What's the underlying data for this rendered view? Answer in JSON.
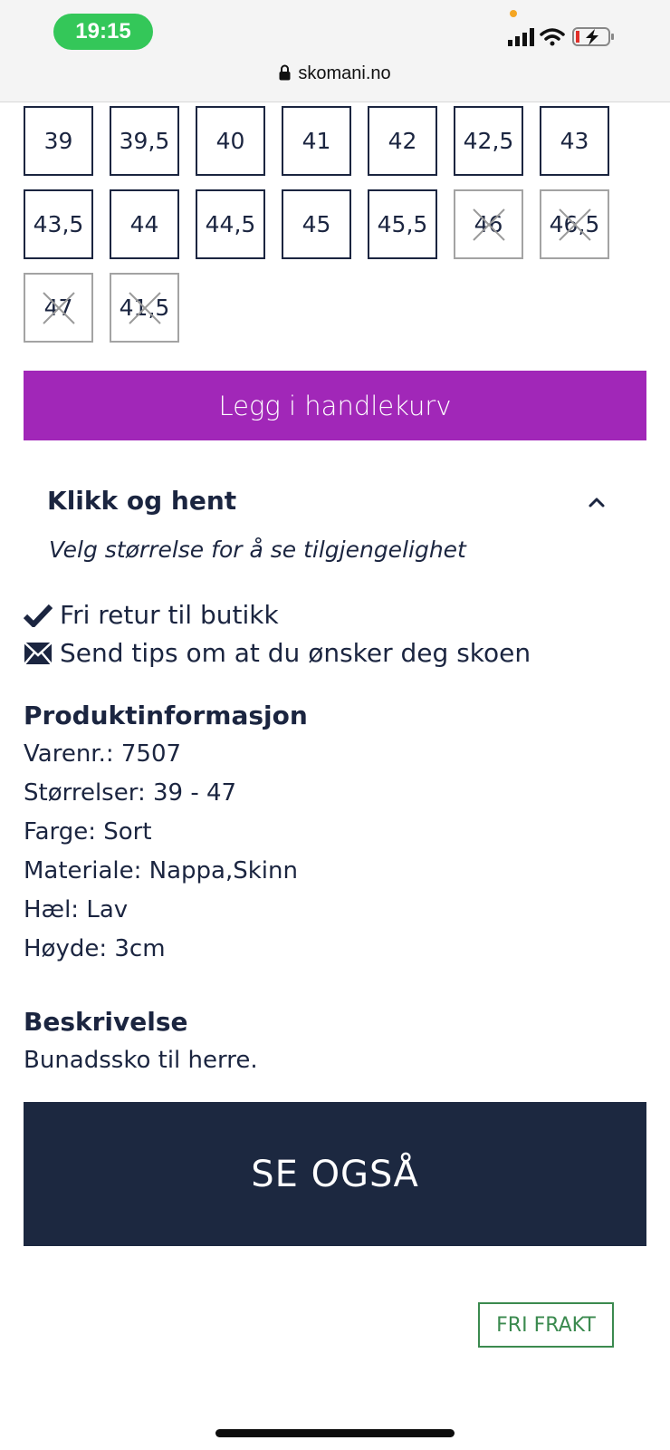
{
  "status_bar": {
    "time": "19:15"
  },
  "browser": {
    "url": "skomani.no"
  },
  "sizes": [
    {
      "label": "39",
      "available": true
    },
    {
      "label": "39,5",
      "available": true
    },
    {
      "label": "40",
      "available": true
    },
    {
      "label": "41",
      "available": true
    },
    {
      "label": "42",
      "available": true
    },
    {
      "label": "42,5",
      "available": true
    },
    {
      "label": "43",
      "available": true
    },
    {
      "label": "43,5",
      "available": true
    },
    {
      "label": "44",
      "available": true
    },
    {
      "label": "44,5",
      "available": true
    },
    {
      "label": "45",
      "available": true
    },
    {
      "label": "45,5",
      "available": true
    },
    {
      "label": "46",
      "available": false
    },
    {
      "label": "46,5",
      "available": false
    },
    {
      "label": "47",
      "available": false
    },
    {
      "label": "41,5",
      "available": false
    }
  ],
  "cart_button": "Legg i handlekurv",
  "click_collect": {
    "title": "Klikk og hent",
    "subtitle": "Velg størrelse for å se tilgjengelighet",
    "icon": "chevron-up-icon"
  },
  "usps": [
    {
      "icon": "check-icon",
      "text": "Fri retur til butikk"
    },
    {
      "icon": "envelope-icon",
      "text": "Send tips om at du ønsker deg skoen"
    }
  ],
  "product_info": {
    "heading": "Produktinformasjon",
    "lines": [
      "Varenr.: 7507",
      "Størrelser: 39 - 47",
      "Farge: Sort",
      "Materiale: Nappa,Skinn",
      "Hæl: Lav",
      "Høyde: 3cm"
    ]
  },
  "description": {
    "heading": "Beskrivelse",
    "text": "Bunadssko til herre."
  },
  "see_also": "SE OGSÅ",
  "badge": "FRI FRAKT",
  "colors": {
    "accent_purple": "#a127b8",
    "navy": "#1c2840",
    "green": "#3b8a4f",
    "status_green": "#34c759"
  }
}
